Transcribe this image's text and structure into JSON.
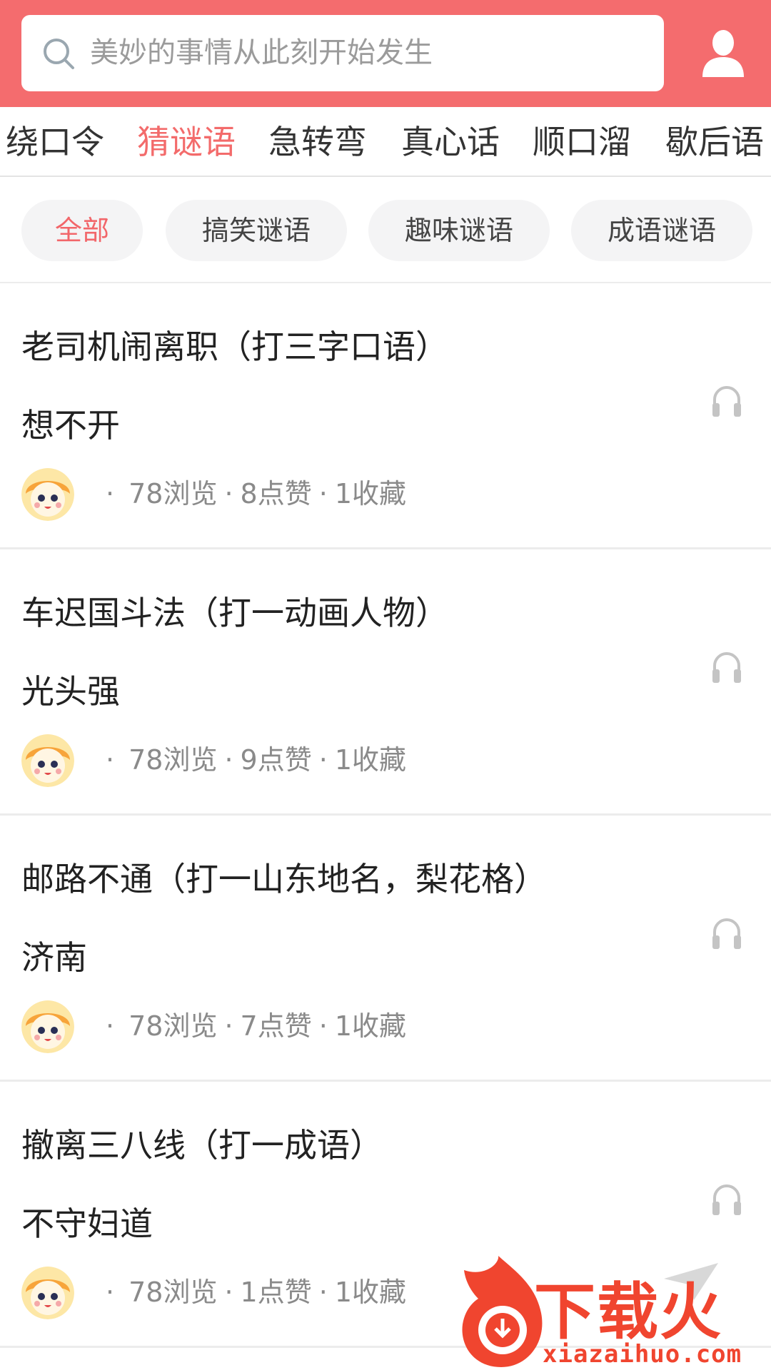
{
  "search": {
    "placeholder": "美妙的事情从此刻开始发生"
  },
  "tabs": [
    {
      "label": "绕口令"
    },
    {
      "label": "猜谜语",
      "active": true
    },
    {
      "label": "急转弯"
    },
    {
      "label": "真心话"
    },
    {
      "label": "顺口溜"
    },
    {
      "label": "歇后语"
    }
  ],
  "filters": [
    {
      "label": "全部",
      "active": true
    },
    {
      "label": "搞笑谜语"
    },
    {
      "label": "趣味谜语"
    },
    {
      "label": "成语谜语"
    }
  ],
  "riddles": [
    {
      "title": "老司机闹离职（打三字口语）",
      "answer": "想不开",
      "views": "78浏览",
      "likes": "8点赞",
      "favorites": "1收藏"
    },
    {
      "title": "车迟国斗法（打一动画人物）",
      "answer": "光头强",
      "views": "78浏览",
      "likes": "9点赞",
      "favorites": "1收藏"
    },
    {
      "title": "邮路不通（打一山东地名，梨花格）",
      "answer": "济南",
      "views": "78浏览",
      "likes": "7点赞",
      "favorites": "1收藏"
    },
    {
      "title": "撤离三八线（打一成语）",
      "answer": "不守妇道",
      "views": "78浏览",
      "likes": "1点赞",
      "favorites": "1收藏"
    }
  ],
  "stats_separator": "·",
  "watermark": {
    "cn": "下载火",
    "en": "xiazaihuo.com"
  },
  "colors": {
    "header": "#f46c6e",
    "accent": "#f36b6b",
    "chip_bg": "#f4f4f5"
  },
  "icons": [
    "search-icon",
    "user-icon",
    "headphone-icon",
    "send-icon"
  ]
}
